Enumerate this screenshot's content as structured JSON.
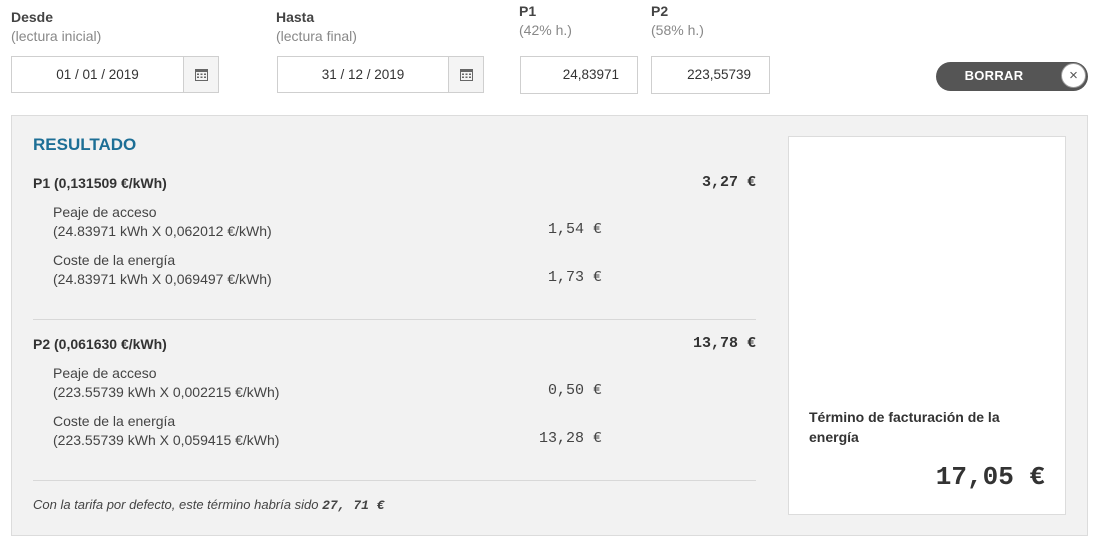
{
  "form": {
    "desde": {
      "label": "Desde",
      "sub": "(lectura inicial)",
      "value": "01 / 01 / 2019"
    },
    "hasta": {
      "label": "Hasta",
      "sub": "(lectura final)",
      "value": "31 / 12 / 2019"
    },
    "p1": {
      "label": "P1",
      "sub": "(42% h.)",
      "value": "24,83971"
    },
    "p2": {
      "label": "P2",
      "sub": "(58% h.)",
      "value": "223,55739"
    },
    "clear_label": "BORRAR",
    "clear_icon": "×"
  },
  "result": {
    "title": "RESULTADO",
    "p1": {
      "head": "P1 (0,131509 €/kWh)",
      "amount": "3,27 €",
      "items": [
        {
          "line1": "Peaje de acceso",
          "line2": "(24.83971 kWh X 0,062012 €/kWh)",
          "amount": "1,54 €"
        },
        {
          "line1": "Coste de la energía",
          "line2": "(24.83971 kWh X 0,069497 €/kWh)",
          "amount": "1,73 €"
        }
      ]
    },
    "p2": {
      "head": "P2 (0,061630 €/kWh)",
      "amount": "13,78 €",
      "items": [
        {
          "line1": "Peaje de acceso",
          "line2": "(223.55739 kWh X 0,002215 €/kWh)",
          "amount": "0,50 €"
        },
        {
          "line1": "Coste de la energía",
          "line2": "(223.55739 kWh X 0,059415 €/kWh)",
          "amount": "13,28 €"
        }
      ]
    },
    "footnote_text": "Con la tarifa por defecto, este término habría sido",
    "footnote_value": "27, 71 €",
    "total_label": "Término de facturación de la energía",
    "total_amount": "17,05 €"
  },
  "colors": {
    "accent": "#1d6f96",
    "button": "#555555",
    "panel": "#f2f2f2"
  }
}
